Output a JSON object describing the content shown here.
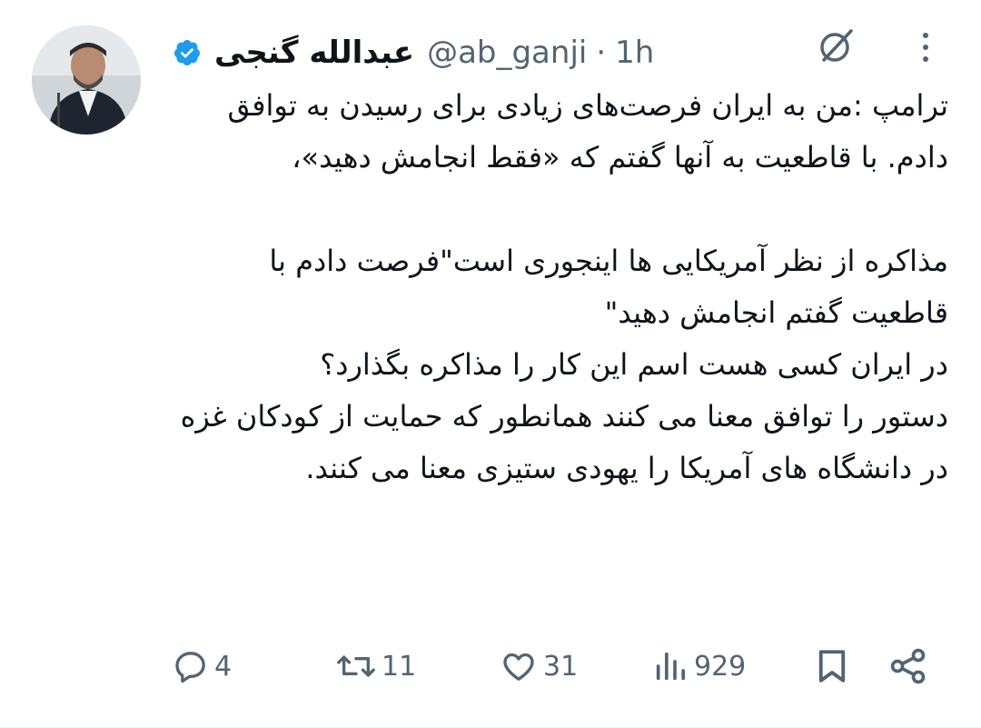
{
  "colors": {
    "verified_badge": "#1d9bf0",
    "muted_text": "#536471",
    "text": "#0f1419"
  },
  "tweet": {
    "author": {
      "display_name": "عبدالله گنجی",
      "handle": "@ab_ganji",
      "separator": "·",
      "time": "1h"
    },
    "text": "ترامپ :من به ایران فرصت‌های زیادی برای رسیدن به توافق دادم. با قاطعیت به آنها گفتم که «فقط انجامش دهید»،\n\nمذاکره از نظر آمریکایی ها اینجوری است\"فرصت دادم با قاطعیت گفتم انجامش دهید\"\nدر ایران کسی هست اسم این کار را مذاکره بگذارد؟\nدستور را توافق معنا می کنند همانطور که حمایت از کودکان غزه در دانشگاه های آمریکا را یهودی ستیزی معنا می کنند."
  },
  "actions": {
    "replies": "4",
    "reposts": "11",
    "likes": "31",
    "views": "929"
  },
  "icons": [
    "verified-badge-icon",
    "grok-icon",
    "more-icon",
    "reply-icon",
    "repost-icon",
    "like-icon",
    "views-icon",
    "bookmark-icon",
    "share-icon"
  ]
}
